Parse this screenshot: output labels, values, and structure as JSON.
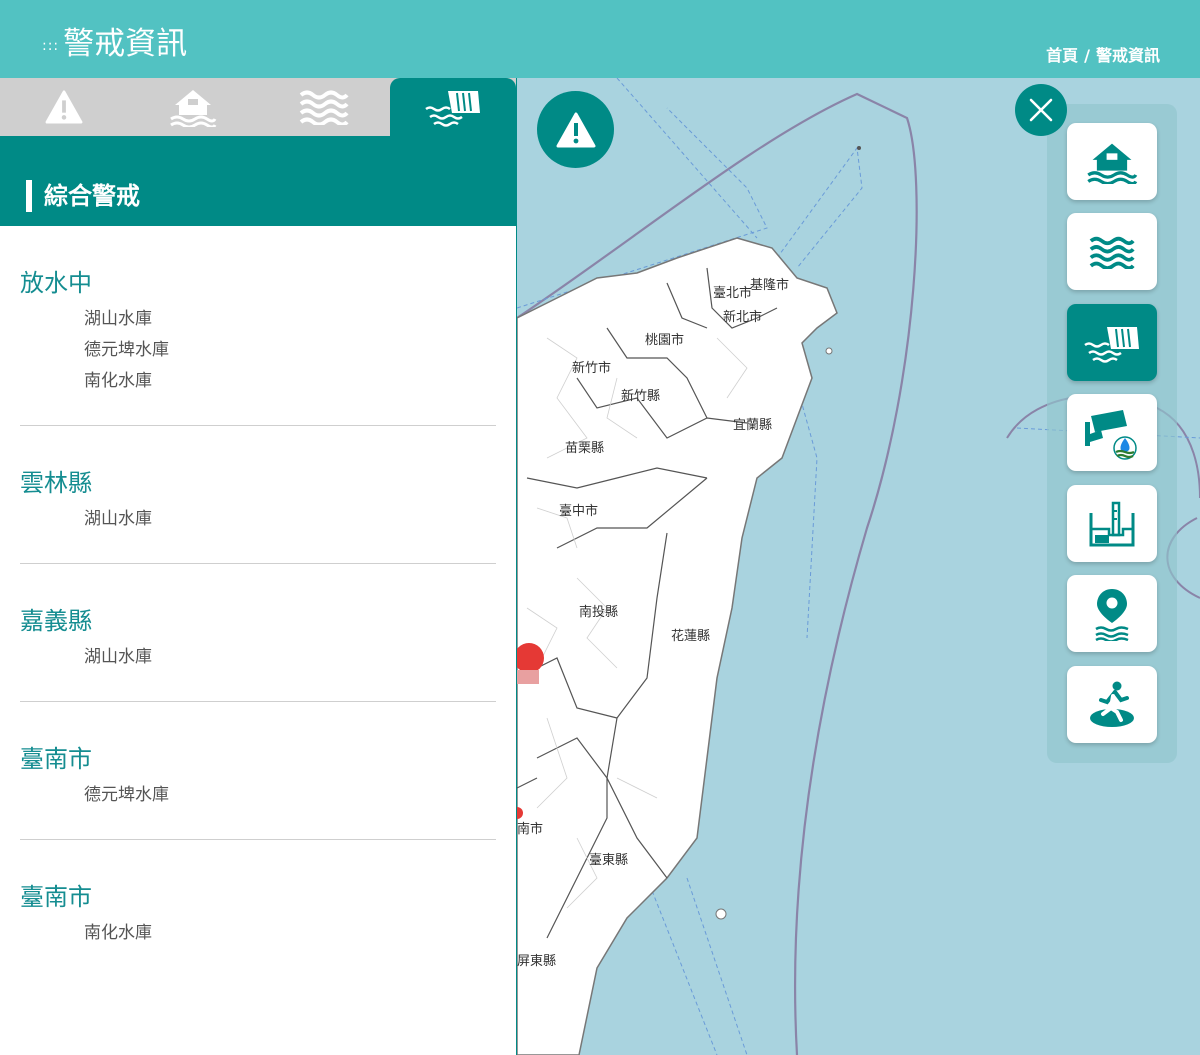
{
  "header": {
    "title_dots": ":::",
    "title": "警戒資訊",
    "breadcrumb": {
      "home": "首頁",
      "separator": "/",
      "current": "警戒資訊"
    }
  },
  "tabs": [
    {
      "icon": "warning-icon",
      "active": false
    },
    {
      "icon": "flooded-house-icon",
      "active": false
    },
    {
      "icon": "waves-icon",
      "active": false
    },
    {
      "icon": "reservoir-dam-icon",
      "active": true
    }
  ],
  "panel": {
    "heading": "綜合警戒",
    "groups": [
      {
        "title": "放水中",
        "items": [
          "湖山水庫",
          "德元埤水庫",
          "南化水庫"
        ]
      },
      {
        "title": "雲林縣",
        "items": [
          "湖山水庫"
        ]
      },
      {
        "title": "嘉義縣",
        "items": [
          "湖山水庫"
        ]
      },
      {
        "title": "臺南市",
        "items": [
          "德元埤水庫"
        ]
      },
      {
        "title": "臺南市",
        "items": [
          "南化水庫"
        ]
      }
    ]
  },
  "map": {
    "labels": [
      "基隆市",
      "臺北市",
      "新北市",
      "桃園市",
      "新竹市",
      "新竹縣",
      "宜蘭縣",
      "苗栗縣",
      "臺中市",
      "南投縣",
      "花蓮縣",
      "臺東縣",
      "屏東縣",
      "南市"
    ]
  },
  "toolbar": {
    "tools": [
      {
        "icon": "flooded-house-icon",
        "active": false
      },
      {
        "icon": "waves-icon",
        "active": false
      },
      {
        "icon": "reservoir-dam-icon",
        "active": true
      },
      {
        "icon": "cctv-camera-icon",
        "active": false
      },
      {
        "icon": "water-level-gauge-icon",
        "active": false
      },
      {
        "icon": "location-pin-water-icon",
        "active": false
      },
      {
        "icon": "evacuation-person-icon",
        "active": false
      }
    ]
  },
  "colors": {
    "primary": "#008a86",
    "header": "#52c2c2",
    "sea": "#a9d3df",
    "group_title": "#158d91"
  }
}
